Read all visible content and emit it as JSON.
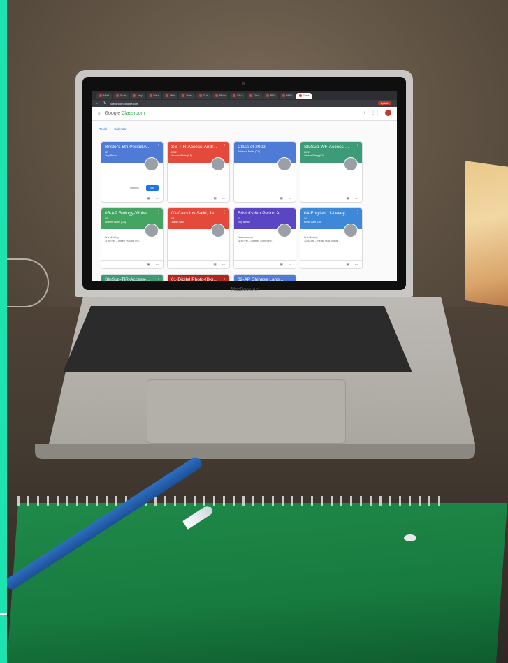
{
  "colors": {
    "frame": "#1de3b0",
    "card_blue": "#4285f4",
    "card_red": "#ea4335",
    "card_teal": "#3c9a76",
    "card_green": "#41a85f",
    "card_purple": "#5e35b1",
    "card_darkred": "#b3261e"
  },
  "browser": {
    "tabs": [
      "Meet",
      "Go-le",
      "Jaky",
      "Dis s",
      "Mtm",
      "Team",
      "Ct m",
      "Photo",
      "Clo e",
      "Drsd",
      "BEH",
      "HRD",
      "Class"
    ],
    "url": "classroom.google.com",
    "update_label": "Update"
  },
  "classroom": {
    "logo_google": "Google",
    "logo_product": "Classroom",
    "todo_label": "To-do",
    "calendar_label": "Calendar",
    "plus_icon": "plus-icon",
    "apps_icon": "apps-grid-icon"
  },
  "cards": [
    {
      "title": "Bristol's 5th Period A...",
      "section": "02",
      "owner": "Troy Bristol",
      "color": "#4f7bd6",
      "due": "",
      "dismiss": "Dismiss",
      "join": "Join"
    },
    {
      "title": "SS-TIR-Access-Andr...",
      "section": "2022",
      "owner": "Andrew White (CA)",
      "color": "#e34a3c",
      "due": ""
    },
    {
      "title": "Class of 2022",
      "section": "",
      "owner": "Rebecca Bellini (CA)",
      "color": "#4f7bd6",
      "due": ""
    },
    {
      "title": "StuSup-WF-Access-...",
      "section": "2022",
      "owner": "Athena Wang (CA)",
      "color": "#3d9b78",
      "due": ""
    },
    {
      "title": "05-AP Biology-White...",
      "section": "05",
      "owner": "Andrew White (CA)",
      "color": "#44a562",
      "due": "Due Monday\n11:59 PM – Speed Practice Fro..."
    },
    {
      "title": "03-Calculus-Saiki, Ja...",
      "section": "03",
      "owner": "Jaimie Saiki",
      "color": "#e34a3c",
      "due": ""
    },
    {
      "title": "Bristol's 6th Period A...",
      "section": "01",
      "owner": "Troy Bristol",
      "color": "#5a46c2",
      "due": "Due tomorrow\n11:59 PM – Chapter 34 Review..."
    },
    {
      "title": "04-English 11-Levey,...",
      "section": "04",
      "owner": "Presli Gazi (CA)",
      "color": "#3f88d9",
      "due": "Due Monday\n12:00 AM – Please read chapte..."
    },
    {
      "title": "StuSup-TIR-Access-...",
      "section": "",
      "owner": "",
      "color": "#3d9b78",
      "due": ""
    },
    {
      "title": "01-Digital Photo-(Bk)...",
      "section": "",
      "owner": "",
      "color": "#b3261e",
      "due": ""
    },
    {
      "title": "02-AP Chinese Lang...",
      "section": "",
      "owner": "",
      "color": "#4f7bd6",
      "due": ""
    }
  ],
  "laptop": {
    "brand": "MacBook Air"
  }
}
